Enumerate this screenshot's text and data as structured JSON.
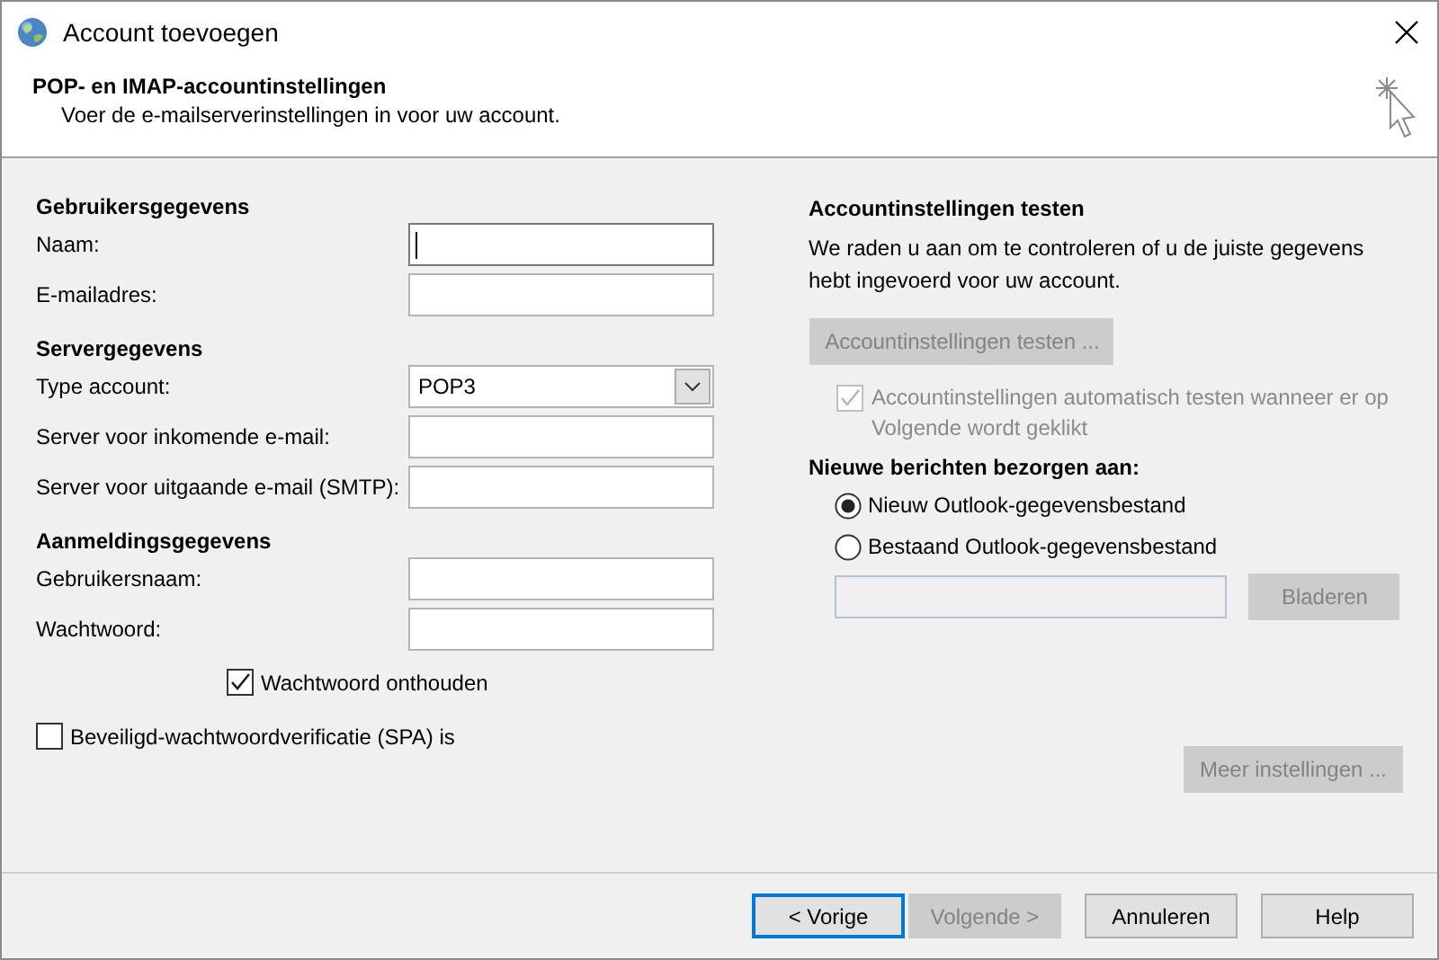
{
  "window": {
    "title": "Account toevoegen"
  },
  "header": {
    "title": "POP- en IMAP-accountinstellingen",
    "subtitle": "Voer de e-mailserverinstellingen in voor uw account."
  },
  "sections": [
    {
      "heading": "Gebruikersgegevens",
      "fields": [
        {
          "label": "Naam:",
          "kind": "text",
          "focused": true
        },
        {
          "label": "E-mailadres:",
          "kind": "text",
          "focused": false
        }
      ]
    },
    {
      "heading": "Servergegevens",
      "fields": [
        {
          "label": "Type account:",
          "kind": "select",
          "value": "POP3",
          "focused": false
        },
        {
          "label": "Server voor inkomende e-mail:",
          "kind": "text",
          "focused": false
        },
        {
          "label": "Server voor uitgaande e-mail (SMTP):",
          "kind": "text",
          "focused": false
        }
      ]
    },
    {
      "heading": "Aanmeldingsgegevens",
      "fields": [
        {
          "label": "Gebruikersnaam:",
          "kind": "text",
          "focused": false
        },
        {
          "label": "Wachtwoord:",
          "kind": "text",
          "focused": false
        }
      ]
    }
  ],
  "remember_password": {
    "label": "Wachtwoord onthouden",
    "checked": true
  },
  "spa": {
    "label": "Beveiligd-wachtwoordverificatie (SPA) is",
    "checked": false
  },
  "test": {
    "heading": "Accountinstellingen testen",
    "description": "We raden u aan om te controleren of u de juiste gegevens hebt ingevoerd voor uw account.",
    "button": {
      "label": "Accountinstellingen testen ...",
      "disabled": true
    },
    "auto_test": {
      "label": "Accountinstellingen automatisch testen wanneer er op Volgende wordt geklikt",
      "checked": true,
      "disabled": true
    }
  },
  "delivery": {
    "heading": "Nieuwe berichten bezorgen aan:",
    "options": [
      {
        "label": "Nieuw Outlook-gegevensbestand",
        "selected": true
      },
      {
        "label": "Bestaand Outlook-gegevensbestand",
        "selected": false
      }
    ],
    "browse": {
      "label": "Bladeren",
      "disabled": true
    }
  },
  "more_settings": {
    "label": "Meer instellingen ...",
    "disabled": true
  },
  "footer_buttons": [
    {
      "label": "< Vorige",
      "disabled": false,
      "default": true
    },
    {
      "label": "Volgende >",
      "disabled": true,
      "default": false
    },
    {
      "label": "Annuleren",
      "disabled": false,
      "default": false
    },
    {
      "label": "Help",
      "disabled": false,
      "default": false
    }
  ]
}
